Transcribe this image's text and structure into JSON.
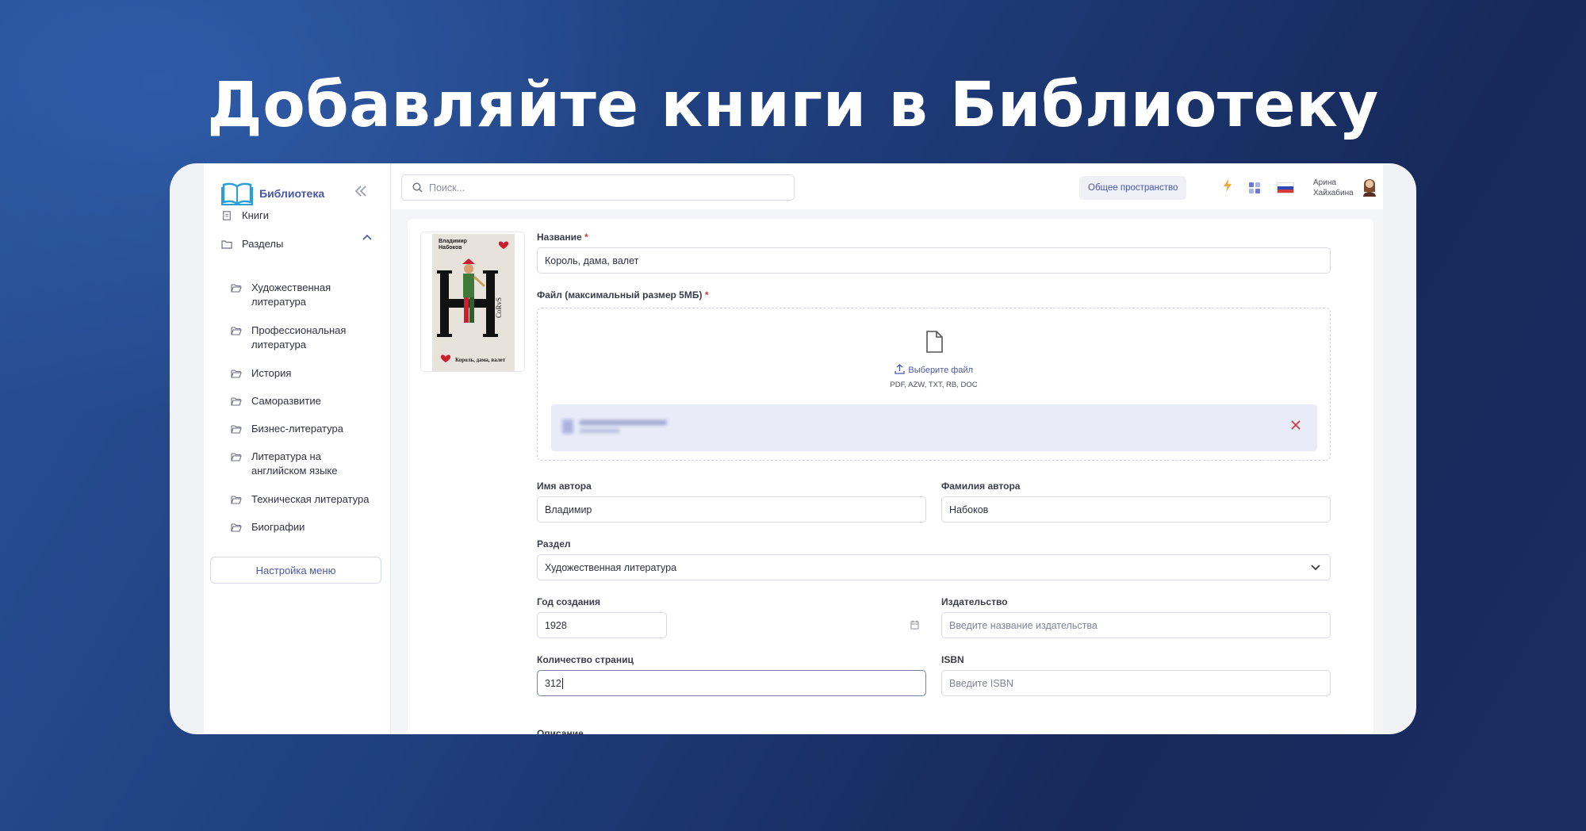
{
  "headline": "Добавляйте книги в Библиотеку",
  "sidebar": {
    "logo_text": "Библиотека",
    "items": [
      {
        "label": "Книги"
      },
      {
        "label": "Разделы"
      }
    ],
    "sections": [
      {
        "label": "Художественная литература"
      },
      {
        "label": "Профессиональная литература"
      },
      {
        "label": "История"
      },
      {
        "label": "Саморазвитие"
      },
      {
        "label": "Бизнес-литература"
      },
      {
        "label": "Литература на английском языке"
      },
      {
        "label": "Техническая литература"
      },
      {
        "label": "Биографии"
      }
    ],
    "menu_button": "Настройка меню"
  },
  "topbar": {
    "search_placeholder": "Поиск...",
    "space_button": "Общее пространство",
    "user_first": "Арина",
    "user_last": "Хайхабина"
  },
  "cover": {
    "author_line1": "Владимир",
    "author_line2": "Набоков",
    "title": "Король, дама, валет"
  },
  "form": {
    "title_label": "Название",
    "title_value": "Король, дама, валет",
    "file_label": "Файл (максимальный размер 5МБ)",
    "choose_file": "Выберите файл",
    "formats": "PDF, AZW, TXT, RB, DOC",
    "author_first_label": "Имя автора",
    "author_first_value": "Владимир",
    "author_last_label": "Фамилия автора",
    "author_last_value": "Набоков",
    "section_label": "Раздел",
    "section_value": "Художественная литература",
    "year_label": "Год создания",
    "year_value": "1928",
    "publisher_label": "Издательство",
    "publisher_placeholder": "Введите название издательства",
    "pages_label": "Количество страниц",
    "pages_value": "312",
    "isbn_label": "ISBN",
    "isbn_placeholder": "Введите ISBN",
    "description_label": "Описание"
  },
  "colors": {
    "accent": "#4a57a8",
    "required": "#d23b3b",
    "bolt": "#f0a53a"
  }
}
